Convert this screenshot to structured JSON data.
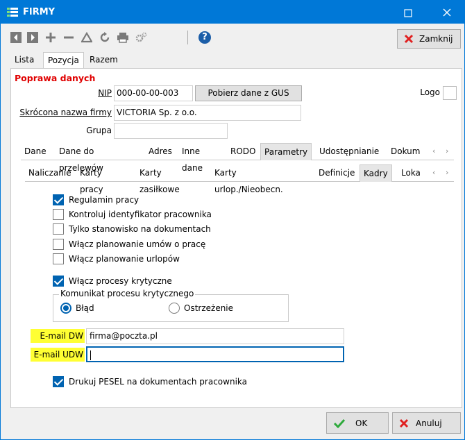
{
  "window": {
    "title": "FIRMY",
    "minimize_icon": "minimize-icon",
    "close_icon": "close-icon"
  },
  "toolbar": {
    "icons": [
      "first-record-icon",
      "last-record-icon",
      "add-icon",
      "remove-icon",
      "warning-icon",
      "refresh-icon",
      "print-icon",
      "settings-icon",
      "help-icon"
    ],
    "help_label": "?",
    "close_label": "Zamknij"
  },
  "main_tabs": {
    "items": [
      "Lista",
      "Pozycja",
      "Razem"
    ],
    "active": "Pozycja"
  },
  "form": {
    "section_title": "Poprawa danych",
    "nip_label": "NIP",
    "nip_value": "000-00-00-003",
    "gus_button": "Pobierz dane z GUS",
    "logo_label": "Logo",
    "short_name_label": "Skrócona nazwa firmy",
    "short_name_value": "VICTORIA Sp. z o.o.",
    "group_label": "Grupa",
    "group_value": ""
  },
  "tabs_level2": {
    "items": [
      "Dane",
      "Dane do przelewów",
      "Adres",
      "Inne dane",
      "RODO",
      "Parametry",
      "Udostępnianie",
      "Dokum"
    ],
    "active": "Parametry"
  },
  "tabs_level3": {
    "items": [
      "Naliczanie",
      "Karty pracy",
      "Karty zasiłkowe",
      "Karty urlop./Nieobecn.",
      "Definicje",
      "Kadry",
      "Loka"
    ],
    "active": "Kadry"
  },
  "kadry": {
    "checkboxes": [
      {
        "label": "Regulamin pracy",
        "checked": true
      },
      {
        "label": "Kontroluj identyfikator pracownika",
        "checked": false
      },
      {
        "label": "Tylko stanowisko na dokumentach",
        "checked": false
      },
      {
        "label": "Włącz planowanie umów o pracę",
        "checked": false
      },
      {
        "label": "Włącz planowanie urlopów",
        "checked": false
      },
      {
        "label": "Włącz procesy krytyczne",
        "checked": true
      }
    ],
    "critical_message_group": {
      "legend": "Komunikat procesu krytycznego",
      "options": [
        {
          "label": "Błąd",
          "selected": true
        },
        {
          "label": "Ostrzeżenie",
          "selected": false
        }
      ]
    },
    "email_dw_label": "E-mail DW",
    "email_dw_value": "firma@poczta.pl",
    "email_udw_label": "E-mail UDW",
    "email_udw_value": "",
    "pesel_checkbox": {
      "label": "Drukuj PESEL na dokumentach pracownika",
      "checked": true
    }
  },
  "footer": {
    "ok_label": "OK",
    "cancel_label": "Anuluj"
  },
  "colors": {
    "titlebar": "#0078d7",
    "accent": "#0063b1",
    "section_title": "#e00000",
    "highlight": "#ffff33",
    "ok_check": "#2eaa3c",
    "cancel_x": "#e02020"
  }
}
